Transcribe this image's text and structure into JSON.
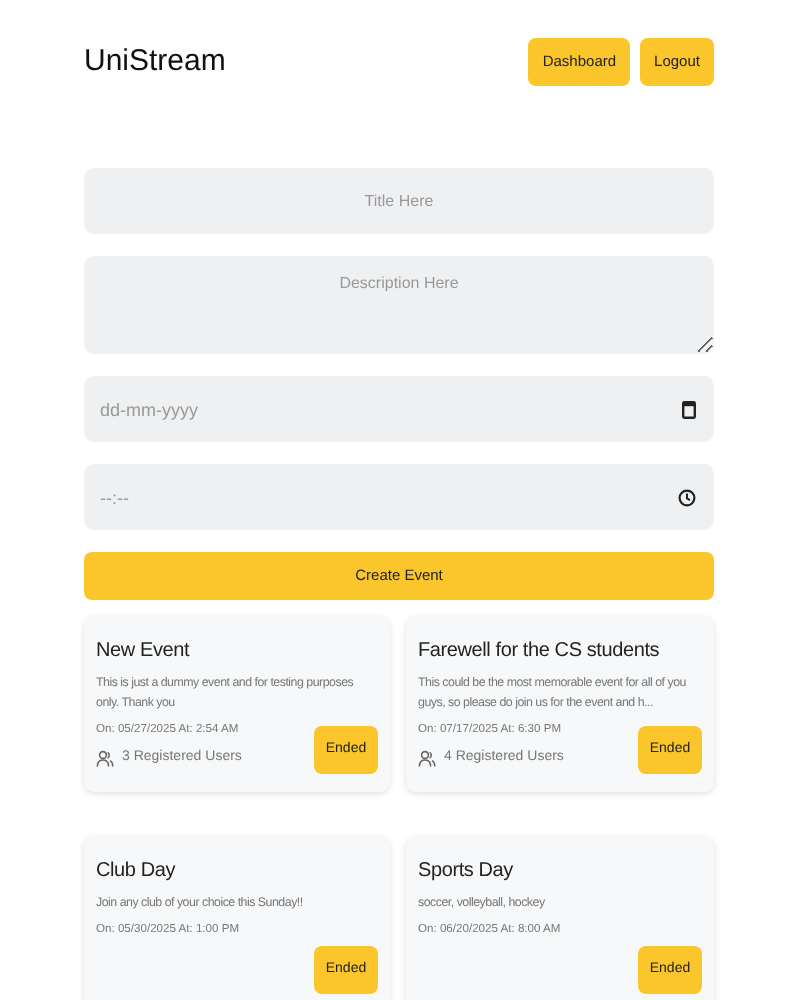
{
  "header": {
    "brand": "UniStream",
    "buttons": [
      "Dashboard",
      "Logout"
    ]
  },
  "form": {
    "fields": [
      {
        "kind": "text",
        "placeholder": "Title Here"
      },
      {
        "kind": "textarea",
        "placeholder": "Description Here"
      },
      {
        "kind": "date",
        "placeholder": "dd-mm-yyyy"
      },
      {
        "kind": "time",
        "placeholder": "--:--"
      }
    ],
    "submit": "Create Event"
  },
  "events": [
    {
      "title": "New Event",
      "description": "This is just a dummy event and for testing purposes only. Thank you",
      "date": "On: 05/27/2025 At: 2:54 AM",
      "users": "3 Registered Users",
      "status": "Ended"
    },
    {
      "title": "Farewell for the CS students",
      "description": "This could be the most memorable event for all of you guys, so please do join us for the event and h...",
      "date": "On: 07/17/2025 At: 6:30 PM",
      "users": "4 Registered Users",
      "status": "Ended"
    },
    {
      "title": "Club Day",
      "description": "Join any club of your choice this Sunday!!",
      "date": "On: 05/30/2025 At: 1:00 PM",
      "status": "Ended"
    },
    {
      "title": "Sports Day",
      "description": "soccer, volleyball, hockey",
      "date": "On: 06/20/2025 At: 8:00 AM",
      "status": "Ended"
    }
  ]
}
